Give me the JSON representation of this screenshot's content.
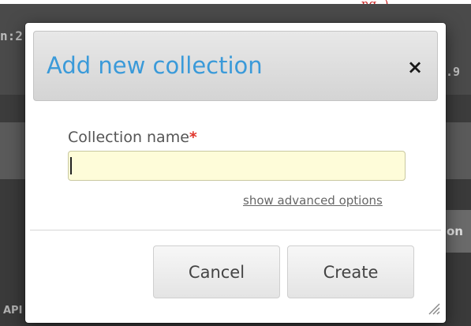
{
  "background": {
    "top_right_fragment": "ng..)",
    "left_fragment": "n:2",
    "right_fragment": ".9",
    "right_button_fragment": "on",
    "bottom_left_fragment": "API"
  },
  "dialog": {
    "title": "Add new collection",
    "close_symbol": "×",
    "field_label": "Collection name",
    "required_marker": "*",
    "input_value": "",
    "advanced_link": "show advanced options",
    "cancel_label": "Cancel",
    "create_label": "Create"
  },
  "colors": {
    "title_blue": "#3a9ad9",
    "required_red": "#e0362c",
    "input_yellow": "#fefcd9"
  },
  "icons": {
    "close": "close-icon",
    "resize": "resize-grip-icon"
  }
}
